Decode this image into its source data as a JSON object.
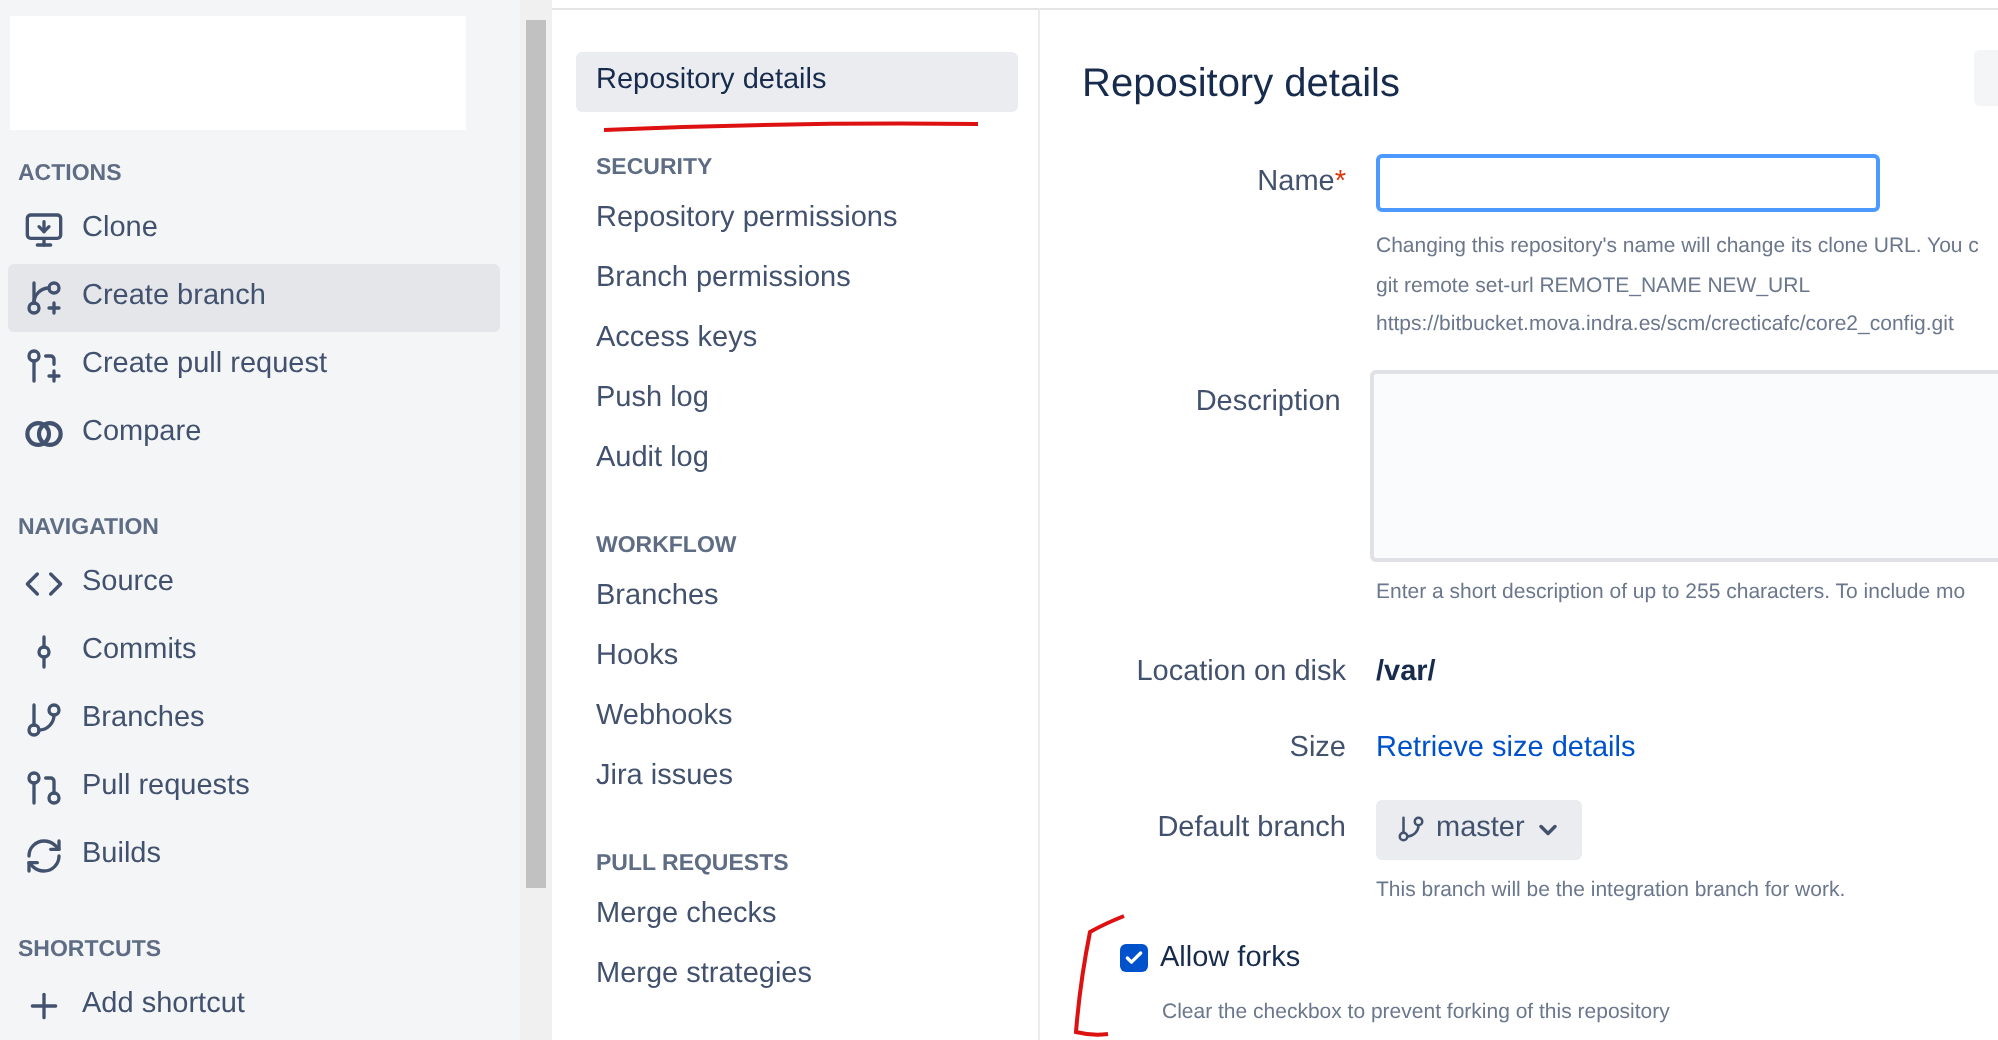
{
  "sidebar": {
    "sections": [
      {
        "title": "ACTIONS",
        "items": [
          {
            "label": "Clone",
            "kind": "clone",
            "selected": false
          },
          {
            "label": "Create branch",
            "kind": "branch-plus",
            "selected": true
          },
          {
            "label": "Create pull request",
            "kind": "pr-create",
            "selected": false
          },
          {
            "label": "Compare",
            "kind": "compare",
            "selected": false
          }
        ]
      },
      {
        "title": "NAVIGATION",
        "items": [
          {
            "label": "Source",
            "kind": "code",
            "selected": false
          },
          {
            "label": "Commits",
            "kind": "commit",
            "selected": false
          },
          {
            "label": "Branches",
            "kind": "branch",
            "selected": false
          },
          {
            "label": "Pull requests",
            "kind": "pr",
            "selected": false
          },
          {
            "label": "Builds",
            "kind": "builds",
            "selected": false
          }
        ]
      },
      {
        "title": "SHORTCUTS",
        "items": [
          {
            "label": "Add shortcut",
            "kind": "plus",
            "selected": false
          }
        ]
      }
    ]
  },
  "settings_nav": {
    "top": {
      "label": "Repository details",
      "selected": true
    },
    "sections": [
      {
        "title": "SECURITY",
        "items": [
          {
            "label": "Repository permissions",
            "selected": false
          },
          {
            "label": "Branch permissions",
            "selected": false
          },
          {
            "label": "Access keys",
            "selected": false
          },
          {
            "label": "Push log",
            "selected": false
          },
          {
            "label": "Audit log",
            "selected": false
          }
        ]
      },
      {
        "title": "WORKFLOW",
        "items": [
          {
            "label": "Branches",
            "selected": false
          },
          {
            "label": "Hooks",
            "selected": false
          },
          {
            "label": "Webhooks",
            "selected": false
          },
          {
            "label": "Jira issues",
            "selected": false
          }
        ]
      },
      {
        "title": "PULL REQUESTS",
        "items": [
          {
            "label": "Merge checks",
            "selected": false
          },
          {
            "label": "Merge strategies",
            "selected": false
          }
        ]
      }
    ]
  },
  "main": {
    "title": "Repository details",
    "name_field": {
      "label": "Name",
      "required_mark": "*",
      "help": [
        "Changing this repository's name will change its clone URL. You c",
        "git remote set-url REMOTE_NAME NEW_URL",
        "https://bitbucket.mova.indra.es/scm/crecticafc/core2_config.git"
      ]
    },
    "description_field": {
      "label": "Description",
      "help": "Enter a short description of up to 255 characters. To include mo"
    },
    "location": {
      "label": "Location on disk",
      "value": "/var/"
    },
    "size": {
      "label": "Size",
      "link": "Retrieve size details"
    },
    "default_branch": {
      "label": "Default branch",
      "value": "master",
      "help": "This branch will be the integration branch for work."
    },
    "allow_forks": {
      "label": "Allow forks",
      "checked": true,
      "help": "Clear the checkbox to prevent forking of this repository"
    }
  }
}
